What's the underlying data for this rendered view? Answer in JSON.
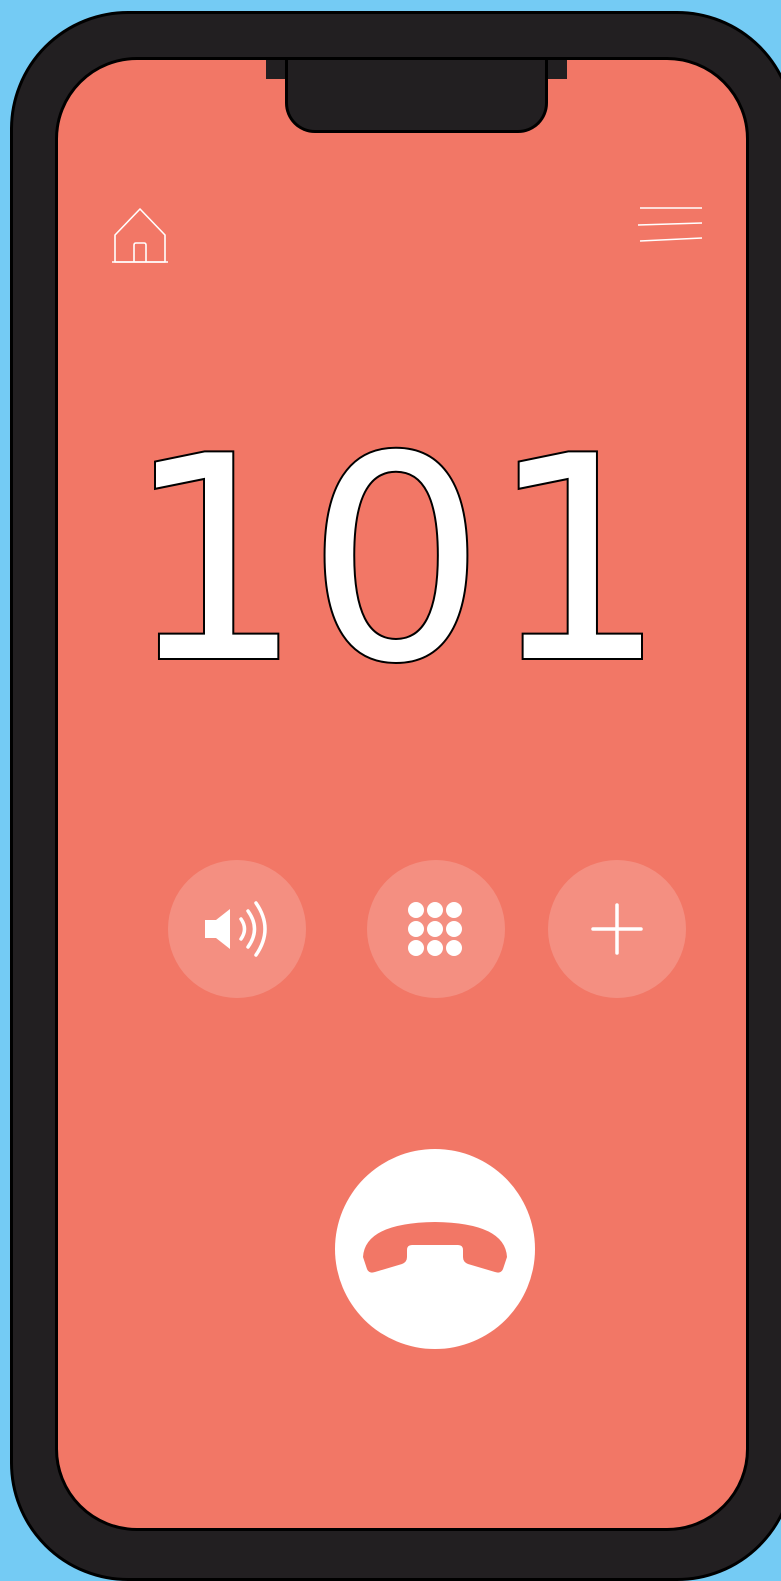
{
  "call": {
    "dialed_number": "101"
  },
  "header": {
    "home_icon": "home-icon",
    "menu_icon": "hamburger-menu-icon"
  },
  "controls": [
    {
      "icon": "speaker-icon"
    },
    {
      "icon": "keypad-icon"
    },
    {
      "icon": "add-call-icon"
    }
  ],
  "end_call": {
    "icon": "hang-up-phone-icon"
  },
  "colors": {
    "background": "#74cbf4",
    "frame": "#221f21",
    "screen": "#f27766",
    "foreground": "#ffffff"
  }
}
